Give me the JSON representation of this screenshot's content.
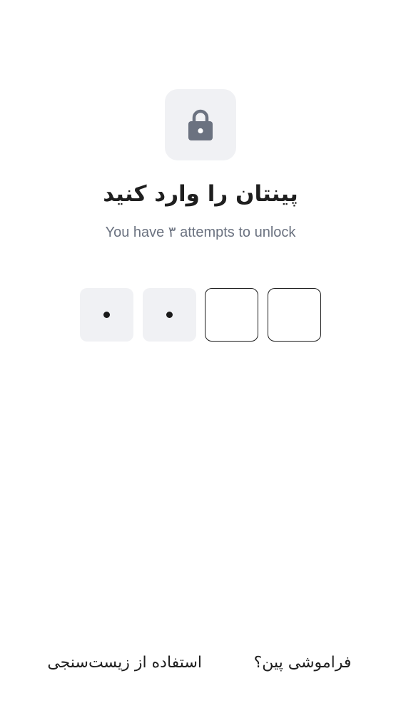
{
  "lock": {
    "icon": "lock-icon",
    "tile_color": "#f0f1f4",
    "icon_color": "#6b7280"
  },
  "header": {
    "title": "پینتان را وارد کنید",
    "subtitle": "You have ۳ attempts to unlock"
  },
  "pin": {
    "length": 4,
    "entered": 2,
    "filled_color": "#f0f1f4",
    "border_color": "#1a1a1a"
  },
  "footer": {
    "biometric_label": "استفاده از زیست‌سنجی",
    "forgot_label": "فراموشی پین؟"
  }
}
